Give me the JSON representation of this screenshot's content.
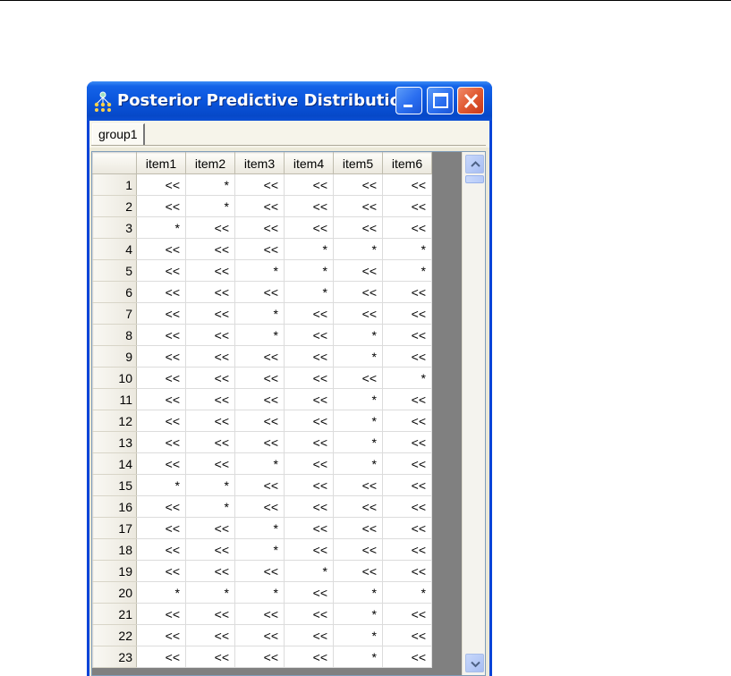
{
  "window": {
    "title": "Posterior Predictive Distributions",
    "controls": [
      "minimize",
      "maximize",
      "close"
    ],
    "icon": "network-app-icon"
  },
  "tabs": [
    {
      "label": "group1",
      "selected": true
    }
  ],
  "grid": {
    "columns": [
      "item1",
      "item2",
      "item3",
      "item4",
      "item5",
      "item6"
    ],
    "rows": [
      {
        "id": "1",
        "cells": [
          "<<",
          "*",
          "<<",
          "<<",
          "<<",
          "<<"
        ]
      },
      {
        "id": "2",
        "cells": [
          "<<",
          "*",
          "<<",
          "<<",
          "<<",
          "<<"
        ]
      },
      {
        "id": "3",
        "cells": [
          "*",
          "<<",
          "<<",
          "<<",
          "<<",
          "<<"
        ]
      },
      {
        "id": "4",
        "cells": [
          "<<",
          "<<",
          "<<",
          "*",
          "*",
          "*"
        ]
      },
      {
        "id": "5",
        "cells": [
          "<<",
          "<<",
          "*",
          "*",
          "<<",
          "*"
        ]
      },
      {
        "id": "6",
        "cells": [
          "<<",
          "<<",
          "<<",
          "*",
          "<<",
          "<<"
        ]
      },
      {
        "id": "7",
        "cells": [
          "<<",
          "<<",
          "*",
          "<<",
          "<<",
          "<<"
        ]
      },
      {
        "id": "8",
        "cells": [
          "<<",
          "<<",
          "*",
          "<<",
          "*",
          "<<"
        ]
      },
      {
        "id": "9",
        "cells": [
          "<<",
          "<<",
          "<<",
          "<<",
          "*",
          "<<"
        ]
      },
      {
        "id": "10",
        "cells": [
          "<<",
          "<<",
          "<<",
          "<<",
          "<<",
          "*"
        ]
      },
      {
        "id": "11",
        "cells": [
          "<<",
          "<<",
          "<<",
          "<<",
          "*",
          "<<"
        ]
      },
      {
        "id": "12",
        "cells": [
          "<<",
          "<<",
          "<<",
          "<<",
          "*",
          "<<"
        ]
      },
      {
        "id": "13",
        "cells": [
          "<<",
          "<<",
          "<<",
          "<<",
          "*",
          "<<"
        ]
      },
      {
        "id": "14",
        "cells": [
          "<<",
          "<<",
          "*",
          "<<",
          "*",
          "<<"
        ]
      },
      {
        "id": "15",
        "cells": [
          "*",
          "*",
          "<<",
          "<<",
          "<<",
          "<<"
        ]
      },
      {
        "id": "16",
        "cells": [
          "<<",
          "*",
          "<<",
          "<<",
          "<<",
          "<<"
        ]
      },
      {
        "id": "17",
        "cells": [
          "<<",
          "<<",
          "*",
          "<<",
          "<<",
          "<<"
        ]
      },
      {
        "id": "18",
        "cells": [
          "<<",
          "<<",
          "*",
          "<<",
          "<<",
          "<<"
        ]
      },
      {
        "id": "19",
        "cells": [
          "<<",
          "<<",
          "<<",
          "*",
          "<<",
          "<<"
        ]
      },
      {
        "id": "20",
        "cells": [
          "*",
          "*",
          "*",
          "<<",
          "*",
          "*"
        ]
      },
      {
        "id": "21",
        "cells": [
          "<<",
          "<<",
          "<<",
          "<<",
          "*",
          "<<"
        ]
      },
      {
        "id": "22",
        "cells": [
          "<<",
          "<<",
          "<<",
          "<<",
          "*",
          "<<"
        ]
      },
      {
        "id": "23",
        "cells": [
          "<<",
          "<<",
          "<<",
          "<<",
          "*",
          "<<"
        ]
      }
    ]
  },
  "colors": {
    "titlebar": "#0a55dc",
    "close_button": "#e05a32",
    "grid_empty_area": "#808080"
  }
}
